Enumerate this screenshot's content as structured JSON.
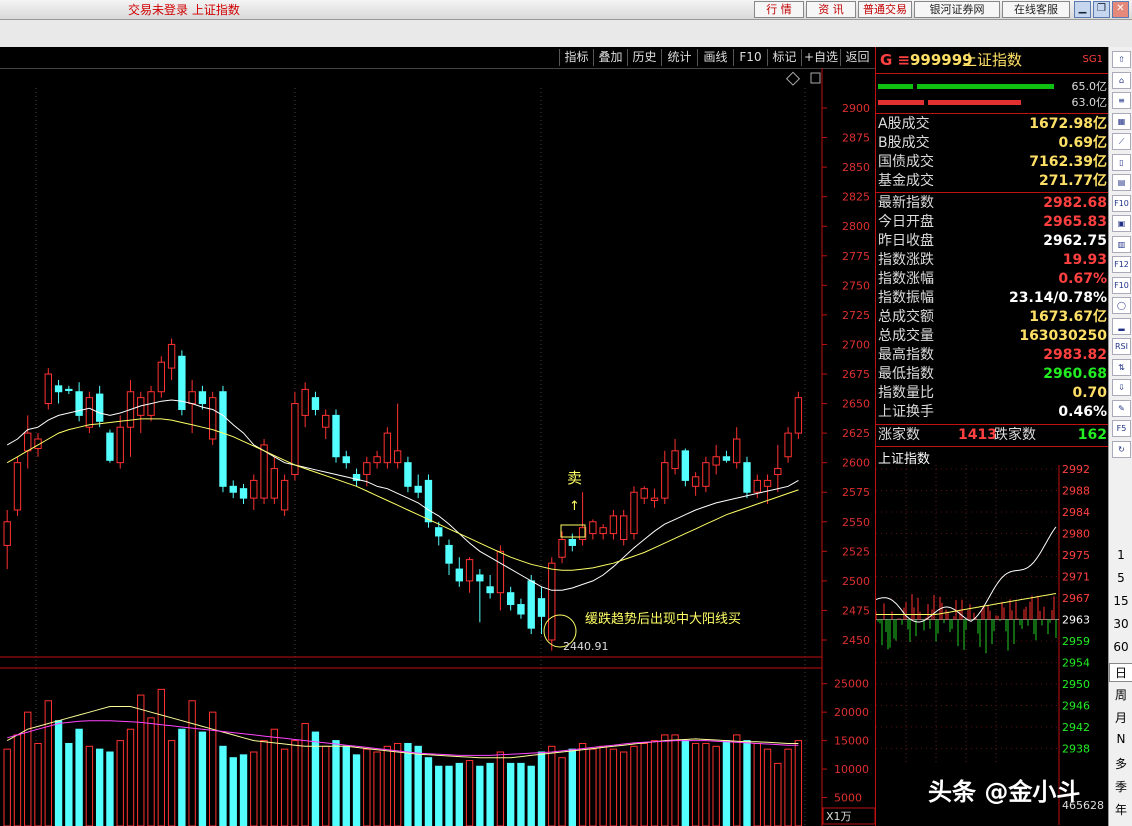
{
  "window": {
    "status": "交易未登录 上证指数",
    "buttons": [
      "行 情",
      "资 讯",
      "普通交易"
    ],
    "broker": "银河证券网",
    "service": "在线客服"
  },
  "toolbar": {
    "items": [
      "指标",
      "叠加",
      "历史",
      "统计",
      "画线",
      "F10",
      "标记",
      "+自选",
      "返回"
    ]
  },
  "main_chart": {
    "price_ticks": [
      "2900",
      "2875",
      "2850",
      "2825",
      "2800",
      "2775",
      "2750",
      "2725",
      "2700",
      "2675",
      "2650",
      "2625",
      "2600",
      "2575",
      "2550",
      "2525",
      "2500",
      "2475",
      "2450"
    ],
    "volume_ticks": [
      "25000",
      "20000",
      "15000",
      "10000",
      "5000"
    ],
    "volume_unit": "X1万",
    "sell_label": "卖",
    "annotation": "缓跌趋势后出现中大阳线买",
    "low_label": "2440.91"
  },
  "chart_data": {
    "type": "candlestick",
    "ylim": [
      2440,
      2910
    ],
    "volume_ylim": [
      0,
      26000
    ],
    "candles": [
      {
        "o": 2530,
        "h": 2560,
        "l": 2510,
        "c": 2550
      },
      {
        "o": 2560,
        "h": 2605,
        "l": 2555,
        "c": 2600
      },
      {
        "o": 2610,
        "h": 2640,
        "l": 2595,
        "c": 2625
      },
      {
        "o": 2612,
        "h": 2625,
        "l": 2605,
        "c": 2620
      },
      {
        "o": 2650,
        "h": 2680,
        "l": 2645,
        "c": 2675
      },
      {
        "o": 2665,
        "h": 2670,
        "l": 2650,
        "c": 2660
      },
      {
        "o": 2662,
        "h": 2665,
        "l": 2658,
        "c": 2661
      },
      {
        "o": 2660,
        "h": 2668,
        "l": 2635,
        "c": 2640
      },
      {
        "o": 2630,
        "h": 2660,
        "l": 2625,
        "c": 2655
      },
      {
        "o": 2658,
        "h": 2665,
        "l": 2630,
        "c": 2635
      },
      {
        "o": 2625,
        "h": 2628,
        "l": 2600,
        "c": 2602
      },
      {
        "o": 2600,
        "h": 2640,
        "l": 2595,
        "c": 2630
      },
      {
        "o": 2630,
        "h": 2670,
        "l": 2605,
        "c": 2660
      },
      {
        "o": 2640,
        "h": 2660,
        "l": 2625,
        "c": 2655
      },
      {
        "o": 2640,
        "h": 2665,
        "l": 2635,
        "c": 2660
      },
      {
        "o": 2660,
        "h": 2690,
        "l": 2655,
        "c": 2685
      },
      {
        "o": 2680,
        "h": 2705,
        "l": 2670,
        "c": 2700
      },
      {
        "o": 2690,
        "h": 2695,
        "l": 2640,
        "c": 2645
      },
      {
        "o": 2650,
        "h": 2670,
        "l": 2625,
        "c": 2660
      },
      {
        "o": 2660,
        "h": 2665,
        "l": 2645,
        "c": 2650
      },
      {
        "o": 2620,
        "h": 2660,
        "l": 2615,
        "c": 2655
      },
      {
        "o": 2660,
        "h": 2665,
        "l": 2575,
        "c": 2580
      },
      {
        "o": 2580,
        "h": 2585,
        "l": 2570,
        "c": 2575
      },
      {
        "o": 2578,
        "h": 2582,
        "l": 2565,
        "c": 2570
      },
      {
        "o": 2570,
        "h": 2590,
        "l": 2560,
        "c": 2585
      },
      {
        "o": 2570,
        "h": 2620,
        "l": 2565,
        "c": 2615
      },
      {
        "o": 2570,
        "h": 2605,
        "l": 2565,
        "c": 2595
      },
      {
        "o": 2560,
        "h": 2590,
        "l": 2555,
        "c": 2585
      },
      {
        "o": 2590,
        "h": 2660,
        "l": 2585,
        "c": 2650
      },
      {
        "o": 2640,
        "h": 2668,
        "l": 2630,
        "c": 2662
      },
      {
        "o": 2655,
        "h": 2660,
        "l": 2640,
        "c": 2645
      },
      {
        "o": 2630,
        "h": 2645,
        "l": 2620,
        "c": 2640
      },
      {
        "o": 2640,
        "h": 2645,
        "l": 2600,
        "c": 2605
      },
      {
        "o": 2605,
        "h": 2610,
        "l": 2595,
        "c": 2600
      },
      {
        "o": 2590,
        "h": 2595,
        "l": 2580,
        "c": 2585
      },
      {
        "o": 2590,
        "h": 2605,
        "l": 2580,
        "c": 2600
      },
      {
        "o": 2600,
        "h": 2610,
        "l": 2595,
        "c": 2605
      },
      {
        "o": 2600,
        "h": 2630,
        "l": 2595,
        "c": 2625
      },
      {
        "o": 2600,
        "h": 2650,
        "l": 2595,
        "c": 2610
      },
      {
        "o": 2600,
        "h": 2605,
        "l": 2575,
        "c": 2580
      },
      {
        "o": 2580,
        "h": 2590,
        "l": 2570,
        "c": 2575
      },
      {
        "o": 2585,
        "h": 2590,
        "l": 2545,
        "c": 2550
      },
      {
        "o": 2545,
        "h": 2550,
        "l": 2530,
        "c": 2538
      },
      {
        "o": 2530,
        "h": 2535,
        "l": 2505,
        "c": 2515
      },
      {
        "o": 2510,
        "h": 2520,
        "l": 2495,
        "c": 2500
      },
      {
        "o": 2500,
        "h": 2520,
        "l": 2490,
        "c": 2518
      },
      {
        "o": 2505,
        "h": 2510,
        "l": 2465,
        "c": 2500
      },
      {
        "o": 2495,
        "h": 2505,
        "l": 2485,
        "c": 2490
      },
      {
        "o": 2490,
        "h": 2530,
        "l": 2475,
        "c": 2525
      },
      {
        "o": 2490,
        "h": 2495,
        "l": 2475,
        "c": 2480
      },
      {
        "o": 2480,
        "h": 2485,
        "l": 2468,
        "c": 2472
      },
      {
        "o": 2500,
        "h": 2505,
        "l": 2455,
        "c": 2460
      },
      {
        "o": 2485,
        "h": 2495,
        "l": 2455,
        "c": 2470
      },
      {
        "o": 2450,
        "h": 2520,
        "l": 2441,
        "c": 2515
      },
      {
        "o": 2520,
        "h": 2542,
        "l": 2515,
        "c": 2535
      },
      {
        "o": 2535,
        "h": 2540,
        "l": 2525,
        "c": 2530
      },
      {
        "o": 2535,
        "h": 2575,
        "l": 2530,
        "c": 2545
      },
      {
        "o": 2540,
        "h": 2552,
        "l": 2535,
        "c": 2550
      },
      {
        "o": 2540,
        "h": 2548,
        "l": 2535,
        "c": 2545
      },
      {
        "o": 2540,
        "h": 2560,
        "l": 2535,
        "c": 2555
      },
      {
        "o": 2535,
        "h": 2560,
        "l": 2530,
        "c": 2555
      },
      {
        "o": 2540,
        "h": 2580,
        "l": 2535,
        "c": 2575
      },
      {
        "o": 2570,
        "h": 2580,
        "l": 2565,
        "c": 2578
      },
      {
        "o": 2568,
        "h": 2578,
        "l": 2562,
        "c": 2570
      },
      {
        "o": 2570,
        "h": 2610,
        "l": 2565,
        "c": 2600
      },
      {
        "o": 2595,
        "h": 2620,
        "l": 2590,
        "c": 2610
      },
      {
        "o": 2610,
        "h": 2612,
        "l": 2580,
        "c": 2585
      },
      {
        "o": 2580,
        "h": 2592,
        "l": 2572,
        "c": 2588
      },
      {
        "o": 2580,
        "h": 2605,
        "l": 2575,
        "c": 2600
      },
      {
        "o": 2598,
        "h": 2615,
        "l": 2590,
        "c": 2605
      },
      {
        "o": 2605,
        "h": 2610,
        "l": 2600,
        "c": 2602
      },
      {
        "o": 2600,
        "h": 2630,
        "l": 2595,
        "c": 2620
      },
      {
        "o": 2600,
        "h": 2605,
        "l": 2570,
        "c": 2575
      },
      {
        "o": 2575,
        "h": 2590,
        "l": 2570,
        "c": 2585
      },
      {
        "o": 2580,
        "h": 2590,
        "l": 2565,
        "c": 2585
      },
      {
        "o": 2590,
        "h": 2615,
        "l": 2575,
        "c": 2595
      },
      {
        "o": 2605,
        "h": 2630,
        "l": 2600,
        "c": 2625
      },
      {
        "o": 2625,
        "h": 2660,
        "l": 2620,
        "c": 2655
      }
    ],
    "volumes": [
      13500,
      16000,
      20000,
      14500,
      22000,
      18500,
      14500,
      17000,
      14000,
      13500,
      13000,
      15000,
      17000,
      23000,
      19000,
      24000,
      15000,
      17000,
      22000,
      16500,
      20000,
      14000,
      12000,
      12500,
      13000,
      15000,
      17000,
      13500,
      15000,
      18000,
      16500,
      14000,
      15000,
      14000,
      12500,
      13500,
      13000,
      14000,
      14500,
      14500,
      14000,
      12000,
      10500,
      10500,
      11000,
      11500,
      10500,
      11000,
      13000,
      11000,
      11000,
      10500,
      13000,
      14000,
      12000,
      13500,
      14500,
      13500,
      14000,
      13500,
      13000,
      14000,
      14500,
      15000,
      16000,
      16000,
      15000,
      14500,
      14500,
      14000,
      15000,
      16000,
      15000,
      14500,
      13500,
      11000,
      13500,
      15000
    ],
    "ma_price_white": [
      2615,
      2620,
      2628,
      2630,
      2636,
      2640,
      2642,
      2644,
      2646,
      2642,
      2640,
      2642,
      2645,
      2648,
      2650,
      2652,
      2653,
      2652,
      2650,
      2647,
      2645,
      2640,
      2632,
      2625,
      2615,
      2610,
      2605,
      2600,
      2598,
      2596,
      2594,
      2592,
      2590,
      2588,
      2586,
      2584,
      2580,
      2578,
      2574,
      2570,
      2566,
      2560,
      2555,
      2548,
      2540,
      2532,
      2525,
      2520,
      2515,
      2510,
      2505,
      2500,
      2495,
      2492,
      2492,
      2494,
      2497,
      2500,
      2505,
      2512,
      2520,
      2528,
      2535,
      2542,
      2548,
      2552,
      2556,
      2560,
      2563,
      2566,
      2568,
      2570,
      2572,
      2574,
      2576,
      2578,
      2580,
      2585
    ],
    "ma_price_yellow": [
      2600,
      2605,
      2610,
      2615,
      2620,
      2625,
      2628,
      2630,
      2632,
      2633,
      2634,
      2635,
      2636,
      2637,
      2637,
      2637,
      2636,
      2634,
      2632,
      2630,
      2628,
      2625,
      2622,
      2618,
      2614,
      2610,
      2606,
      2602,
      2598,
      2595,
      2592,
      2589,
      2586,
      2583,
      2580,
      2576,
      2572,
      2568,
      2564,
      2560,
      2556,
      2552,
      2548,
      2544,
      2540,
      2536,
      2532,
      2528,
      2524,
      2520,
      2517,
      2514,
      2512,
      2510,
      2509,
      2509,
      2510,
      2511,
      2513,
      2515,
      2518,
      2521,
      2524,
      2528,
      2532,
      2536,
      2540,
      2544,
      2548,
      2552,
      2556,
      2559,
      2562,
      2565,
      2568,
      2571,
      2574,
      2577
    ],
    "ma_vol_yellow": [
      15000,
      16000,
      17000,
      17500,
      18000,
      18500,
      19000,
      19500,
      20000,
      20500,
      21000,
      21000,
      21000,
      20500,
      20000,
      19500,
      19000,
      18500,
      18000,
      17500,
      17000,
      16500,
      16000,
      15500,
      15000,
      14800,
      14600,
      14400,
      14200,
      14000,
      14000,
      14000,
      14000,
      14000,
      13800,
      13600,
      13400,
      13200,
      13000,
      12800,
      12600,
      12500,
      12400,
      12300,
      12200,
      12100,
      12000,
      12000,
      12000,
      12000,
      12200,
      12400,
      12600,
      12800,
      13000,
      13200,
      13400,
      13600,
      13800,
      14000,
      14200,
      14400,
      14600,
      14800,
      15000,
      15100,
      15200,
      15300,
      15200,
      15100,
      15000,
      14900,
      14800,
      14800,
      14700,
      14600,
      14500,
      14500
    ],
    "ma_vol_magenta": [
      15500,
      16000,
      16500,
      17000,
      17500,
      18000,
      18200,
      18400,
      18500,
      18500,
      18500,
      18400,
      18300,
      18200,
      18000,
      17800,
      17600,
      17400,
      17200,
      17000,
      16800,
      16600,
      16400,
      16200,
      16000,
      15800,
      15600,
      15400,
      15200,
      15000,
      14800,
      14600,
      14400,
      14200,
      14000,
      13800,
      13600,
      13400,
      13200,
      13000,
      12800,
      12700,
      12600,
      12500,
      12400,
      12400,
      12400,
      12400,
      12500,
      12600,
      12700,
      12800,
      12900,
      13000,
      13200,
      13400,
      13600,
      13800,
      14000,
      14200,
      14400,
      14600,
      14700,
      14800,
      14900,
      15000,
      15000,
      15000,
      15000,
      14900,
      14800,
      14700,
      14600,
      14500,
      14400,
      14300,
      14200,
      14200
    ]
  },
  "stock": {
    "prefix": "G ≡",
    "code": "999999",
    "name": "上证指数",
    "tag": "SG1",
    "bar1": "65.0亿",
    "bar2": "63.0亿"
  },
  "turnover": [
    {
      "label": "A股成交",
      "value": "1672.98亿"
    },
    {
      "label": "B股成交",
      "value": "0.69亿"
    },
    {
      "label": "国债成交",
      "value": "7162.39亿"
    },
    {
      "label": "基金成交",
      "value": "271.77亿"
    }
  ],
  "quote": [
    {
      "label": "最新指数",
      "value": "2982.68",
      "color": "#ff4040"
    },
    {
      "label": "今日开盘",
      "value": "2965.83",
      "color": "#ff4040"
    },
    {
      "label": "昨日收盘",
      "value": "2962.75",
      "color": "#ffffff"
    },
    {
      "label": "指数涨跌",
      "value": "19.93",
      "color": "#ff4040"
    },
    {
      "label": "指数涨幅",
      "value": "0.67%",
      "color": "#ff4040"
    },
    {
      "label": "指数振幅",
      "value": "23.14/0.78%",
      "color": "#ffffff"
    },
    {
      "label": "总成交额",
      "value": "1673.67亿",
      "color": "#ffe066"
    },
    {
      "label": "总成交量",
      "value": "163030250",
      "color": "#ffe066"
    },
    {
      "label": "最高指数",
      "value": "2983.82",
      "color": "#ff4040"
    },
    {
      "label": "最低指数",
      "value": "2960.68",
      "color": "#22ee22"
    },
    {
      "label": "指数量比",
      "value": "0.70",
      "color": "#ffe066"
    },
    {
      "label": "上证换手",
      "value": "0.46%",
      "color": "#ffffff"
    }
  ],
  "breadth": {
    "up_label": "涨家数",
    "up": "1413",
    "down_label": "跌家数",
    "down": "162"
  },
  "mini": {
    "title": "上证指数",
    "ticks": [
      "2992",
      "2988",
      "2984",
      "2980",
      "2975",
      "2971",
      "2967",
      "2963",
      "2959",
      "2954",
      "2950",
      "2946",
      "2942",
      "2938"
    ],
    "volume": "465628"
  },
  "sidebar": {
    "icons": [
      "up-arrow-icon",
      "home-icon",
      "menu-icon",
      "grid-icon",
      "line-chart-icon",
      "candlestick-icon",
      "table-icon",
      "f10-icon",
      "report-icon",
      "news-icon",
      "f12-icon",
      "f10x-icon",
      "circle-icon",
      "bar-icon",
      "rsi-icon",
      "up-down-icon",
      "down-arrow-icon",
      "pen-icon",
      "f5-icon",
      "refresh-icon"
    ],
    "icon_labels": [
      "⇧",
      "⌂",
      "≡",
      "▦",
      "⟋",
      "▯",
      "▤",
      "F10",
      "▣",
      "▥",
      "F12",
      "F10",
      "◯",
      "▂",
      "RSI",
      "⇅",
      "⇩",
      "✎",
      "F5",
      "↻"
    ],
    "periods": [
      "1",
      "5",
      "15",
      "30",
      "60",
      "日",
      "周",
      "月",
      "N",
      "多",
      "季",
      "年"
    ]
  },
  "watermark": "头条 @金小斗"
}
